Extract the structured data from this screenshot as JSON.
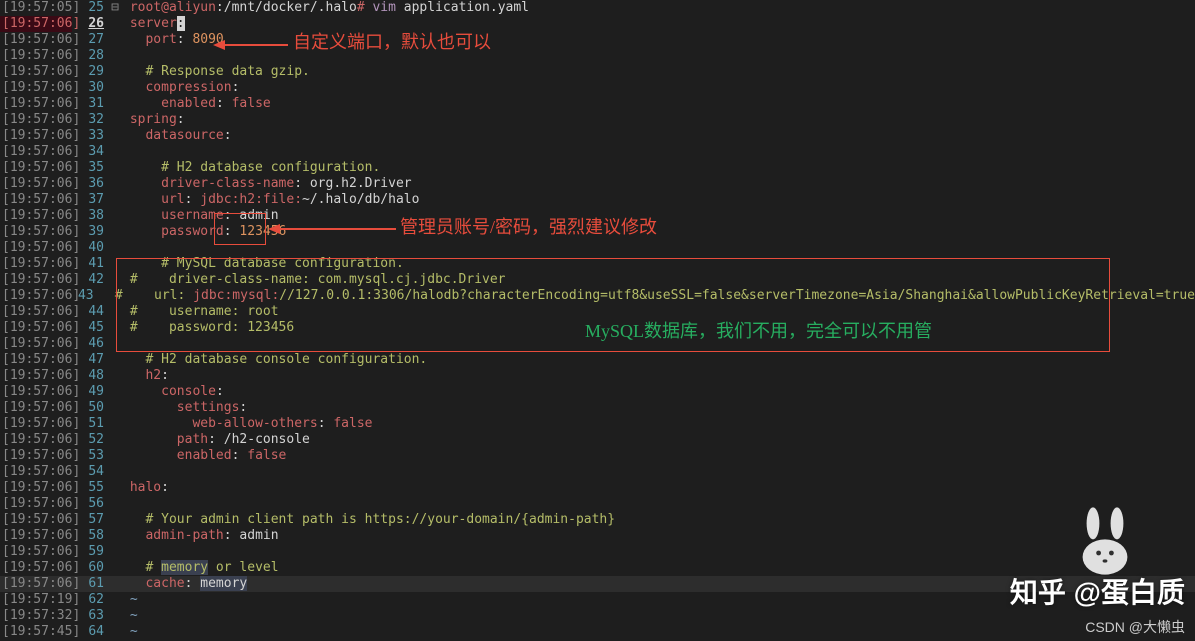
{
  "fold_marker": "⊟",
  "prompt": {
    "user_host": "root@aliyun",
    "path": ":/mnt/docker/.halo",
    "hash": "#",
    "cmd": "vim",
    "arg": "application.yaml"
  },
  "annotations": {
    "port_note": "自定义端口，默认也可以",
    "admin_note": "管理员账号/密码，强烈建议修改",
    "mysql_note": "MySQL数据库，我们不用，完全可以不用管"
  },
  "watermarks": {
    "zhihu": "知乎 @蛋白质",
    "csdn": "CSDN @大懒虫"
  },
  "lines": [
    {
      "ts": "[19:57:05]",
      "n": "25",
      "fold": true,
      "tokens": [
        {
          "t": " ",
          "c": "plain"
        },
        {
          "t": "root@aliyun",
          "c": "prompt-user"
        },
        {
          "t": ":/mnt/docker/.halo",
          "c": "plain"
        },
        {
          "t": "#",
          "c": "prompt-user"
        },
        {
          "t": " ",
          "c": "plain"
        },
        {
          "t": "vim",
          "c": "cmd"
        },
        {
          "t": " application.yaml",
          "c": "plain"
        }
      ]
    },
    {
      "ts": "[19:57:06]",
      "n": "26",
      "hl": true,
      "tokens": [
        {
          "t": " ",
          "c": "plain"
        },
        {
          "t": "server",
          "c": "key"
        },
        {
          "t": ":",
          "c": "cursor-block"
        }
      ]
    },
    {
      "ts": "[19:57:06]",
      "n": "27",
      "tokens": [
        {
          "t": "   ",
          "c": "plain"
        },
        {
          "t": "port",
          "c": "key"
        },
        {
          "t": ": ",
          "c": "plain"
        },
        {
          "t": "8090",
          "c": "number"
        }
      ]
    },
    {
      "ts": "[19:57:06]",
      "n": "28",
      "tokens": []
    },
    {
      "ts": "[19:57:06]",
      "n": "29",
      "tokens": [
        {
          "t": "   ",
          "c": "plain"
        },
        {
          "t": "# Response data gzip.",
          "c": "comment"
        }
      ]
    },
    {
      "ts": "[19:57:06]",
      "n": "30",
      "tokens": [
        {
          "t": "   ",
          "c": "plain"
        },
        {
          "t": "compression",
          "c": "key"
        },
        {
          "t": ":",
          "c": "plain"
        }
      ]
    },
    {
      "ts": "[19:57:06]",
      "n": "31",
      "tokens": [
        {
          "t": "     ",
          "c": "plain"
        },
        {
          "t": "enabled",
          "c": "key"
        },
        {
          "t": ": ",
          "c": "plain"
        },
        {
          "t": "false",
          "c": "bool"
        }
      ]
    },
    {
      "ts": "[19:57:06]",
      "n": "32",
      "tokens": [
        {
          "t": " ",
          "c": "plain"
        },
        {
          "t": "spring",
          "c": "key"
        },
        {
          "t": ":",
          "c": "plain"
        }
      ]
    },
    {
      "ts": "[19:57:06]",
      "n": "33",
      "tokens": [
        {
          "t": "   ",
          "c": "plain"
        },
        {
          "t": "datasource",
          "c": "key"
        },
        {
          "t": ":",
          "c": "plain"
        }
      ]
    },
    {
      "ts": "[19:57:06]",
      "n": "34",
      "tokens": []
    },
    {
      "ts": "[19:57:06]",
      "n": "35",
      "tokens": [
        {
          "t": "     ",
          "c": "plain"
        },
        {
          "t": "# H2 database configuration.",
          "c": "comment"
        }
      ]
    },
    {
      "ts": "[19:57:06]",
      "n": "36",
      "tokens": [
        {
          "t": "     ",
          "c": "plain"
        },
        {
          "t": "driver-class-name",
          "c": "key"
        },
        {
          "t": ": org.h2.Driver",
          "c": "plain"
        }
      ]
    },
    {
      "ts": "[19:57:06]",
      "n": "37",
      "tokens": [
        {
          "t": "     ",
          "c": "plain"
        },
        {
          "t": "url",
          "c": "key"
        },
        {
          "t": ": ",
          "c": "plain"
        },
        {
          "t": "jdbc:h2:file:",
          "c": "key"
        },
        {
          "t": "~/.halo/db/halo",
          "c": "plain"
        }
      ]
    },
    {
      "ts": "[19:57:06]",
      "n": "38",
      "tokens": [
        {
          "t": "     ",
          "c": "plain"
        },
        {
          "t": "username",
          "c": "key"
        },
        {
          "t": ": admin",
          "c": "plain"
        }
      ]
    },
    {
      "ts": "[19:57:06]",
      "n": "39",
      "tokens": [
        {
          "t": "     ",
          "c": "plain"
        },
        {
          "t": "password",
          "c": "key"
        },
        {
          "t": ": ",
          "c": "plain"
        },
        {
          "t": "123456",
          "c": "number"
        }
      ]
    },
    {
      "ts": "[19:57:06]",
      "n": "40",
      "tokens": []
    },
    {
      "ts": "[19:57:06]",
      "n": "41",
      "tokens": [
        {
          "t": "     ",
          "c": "plain"
        },
        {
          "t": "# MySQL database configuration.",
          "c": "comment"
        }
      ]
    },
    {
      "ts": "[19:57:06]",
      "n": "42",
      "tokens": [
        {
          "t": " ",
          "c": "plain"
        },
        {
          "t": "#    driver-class-name: com.mysql.cj.jdbc.Driver",
          "c": "comment"
        }
      ]
    },
    {
      "ts": "[19:57:06]",
      "n": "43",
      "tokens": [
        {
          "t": " ",
          "c": "plain"
        },
        {
          "t": "#    url: ",
          "c": "comment"
        },
        {
          "t": "jdbc:mysql:",
          "c": "key"
        },
        {
          "t": "//127.0.0.1:3306/halodb?characterEncoding=utf8&useSSL=false&serverTimezone=Asia/Shanghai&allowPublicKeyRetrieval=true",
          "c": "comment"
        }
      ]
    },
    {
      "ts": "[19:57:06]",
      "n": "44",
      "tokens": [
        {
          "t": " ",
          "c": "plain"
        },
        {
          "t": "#    username: root",
          "c": "comment"
        }
      ]
    },
    {
      "ts": "[19:57:06]",
      "n": "45",
      "tokens": [
        {
          "t": " ",
          "c": "plain"
        },
        {
          "t": "#    password: 123456",
          "c": "comment"
        }
      ]
    },
    {
      "ts": "[19:57:06]",
      "n": "46",
      "tokens": []
    },
    {
      "ts": "[19:57:06]",
      "n": "47",
      "tokens": [
        {
          "t": "   ",
          "c": "plain"
        },
        {
          "t": "# H2 database console configuration.",
          "c": "comment"
        }
      ]
    },
    {
      "ts": "[19:57:06]",
      "n": "48",
      "tokens": [
        {
          "t": "   ",
          "c": "plain"
        },
        {
          "t": "h2",
          "c": "key"
        },
        {
          "t": ":",
          "c": "plain"
        }
      ]
    },
    {
      "ts": "[19:57:06]",
      "n": "49",
      "tokens": [
        {
          "t": "     ",
          "c": "plain"
        },
        {
          "t": "console",
          "c": "key"
        },
        {
          "t": ":",
          "c": "plain"
        }
      ]
    },
    {
      "ts": "[19:57:06]",
      "n": "50",
      "tokens": [
        {
          "t": "       ",
          "c": "plain"
        },
        {
          "t": "settings",
          "c": "key"
        },
        {
          "t": ":",
          "c": "plain"
        }
      ]
    },
    {
      "ts": "[19:57:06]",
      "n": "51",
      "tokens": [
        {
          "t": "         ",
          "c": "plain"
        },
        {
          "t": "web-allow-others",
          "c": "key"
        },
        {
          "t": ": ",
          "c": "plain"
        },
        {
          "t": "false",
          "c": "bool"
        }
      ]
    },
    {
      "ts": "[19:57:06]",
      "n": "52",
      "tokens": [
        {
          "t": "       ",
          "c": "plain"
        },
        {
          "t": "path",
          "c": "key"
        },
        {
          "t": ": /h2-console",
          "c": "plain"
        }
      ]
    },
    {
      "ts": "[19:57:06]",
      "n": "53",
      "tokens": [
        {
          "t": "       ",
          "c": "plain"
        },
        {
          "t": "enabled",
          "c": "key"
        },
        {
          "t": ": ",
          "c": "plain"
        },
        {
          "t": "false",
          "c": "bool"
        }
      ]
    },
    {
      "ts": "[19:57:06]",
      "n": "54",
      "tokens": []
    },
    {
      "ts": "[19:57:06]",
      "n": "55",
      "tokens": [
        {
          "t": " ",
          "c": "plain"
        },
        {
          "t": "halo",
          "c": "key"
        },
        {
          "t": ":",
          "c": "plain"
        }
      ]
    },
    {
      "ts": "[19:57:06]",
      "n": "56",
      "tokens": []
    },
    {
      "ts": "[19:57:06]",
      "n": "57",
      "tokens": [
        {
          "t": "   ",
          "c": "plain"
        },
        {
          "t": "# Your admin client path is https://your-domain/{admin-path}",
          "c": "comment"
        }
      ]
    },
    {
      "ts": "[19:57:06]",
      "n": "58",
      "tokens": [
        {
          "t": "   ",
          "c": "plain"
        },
        {
          "t": "admin-path",
          "c": "key"
        },
        {
          "t": ": admin",
          "c": "plain"
        }
      ]
    },
    {
      "ts": "[19:57:06]",
      "n": "59",
      "tokens": []
    },
    {
      "ts": "[19:57:06]",
      "n": "60",
      "tokens": [
        {
          "t": "   ",
          "c": "plain"
        },
        {
          "t": "# ",
          "c": "comment"
        },
        {
          "t": "memory",
          "c": "comment",
          "bg": true
        },
        {
          "t": " or level",
          "c": "comment"
        }
      ]
    },
    {
      "ts": "[19:57:06]",
      "n": "61",
      "tokens": [
        {
          "t": "   ",
          "c": "plain"
        },
        {
          "t": "cache",
          "c": "key"
        },
        {
          "t": ": ",
          "c": "plain"
        },
        {
          "t": "memory",
          "c": "plain",
          "bg": true
        }
      ]
    },
    {
      "ts": "[19:57:19]",
      "n": "62",
      "tokens": [
        {
          "t": " ",
          "c": "plain"
        },
        {
          "t": "~",
          "c": "tilde"
        }
      ]
    },
    {
      "ts": "[19:57:32]",
      "n": "63",
      "tokens": [
        {
          "t": " ",
          "c": "plain"
        },
        {
          "t": "~",
          "c": "tilde"
        }
      ]
    },
    {
      "ts": "[19:57:45]",
      "n": "64",
      "tokens": [
        {
          "t": " ",
          "c": "plain"
        },
        {
          "t": "~",
          "c": "tilde"
        }
      ]
    }
  ]
}
